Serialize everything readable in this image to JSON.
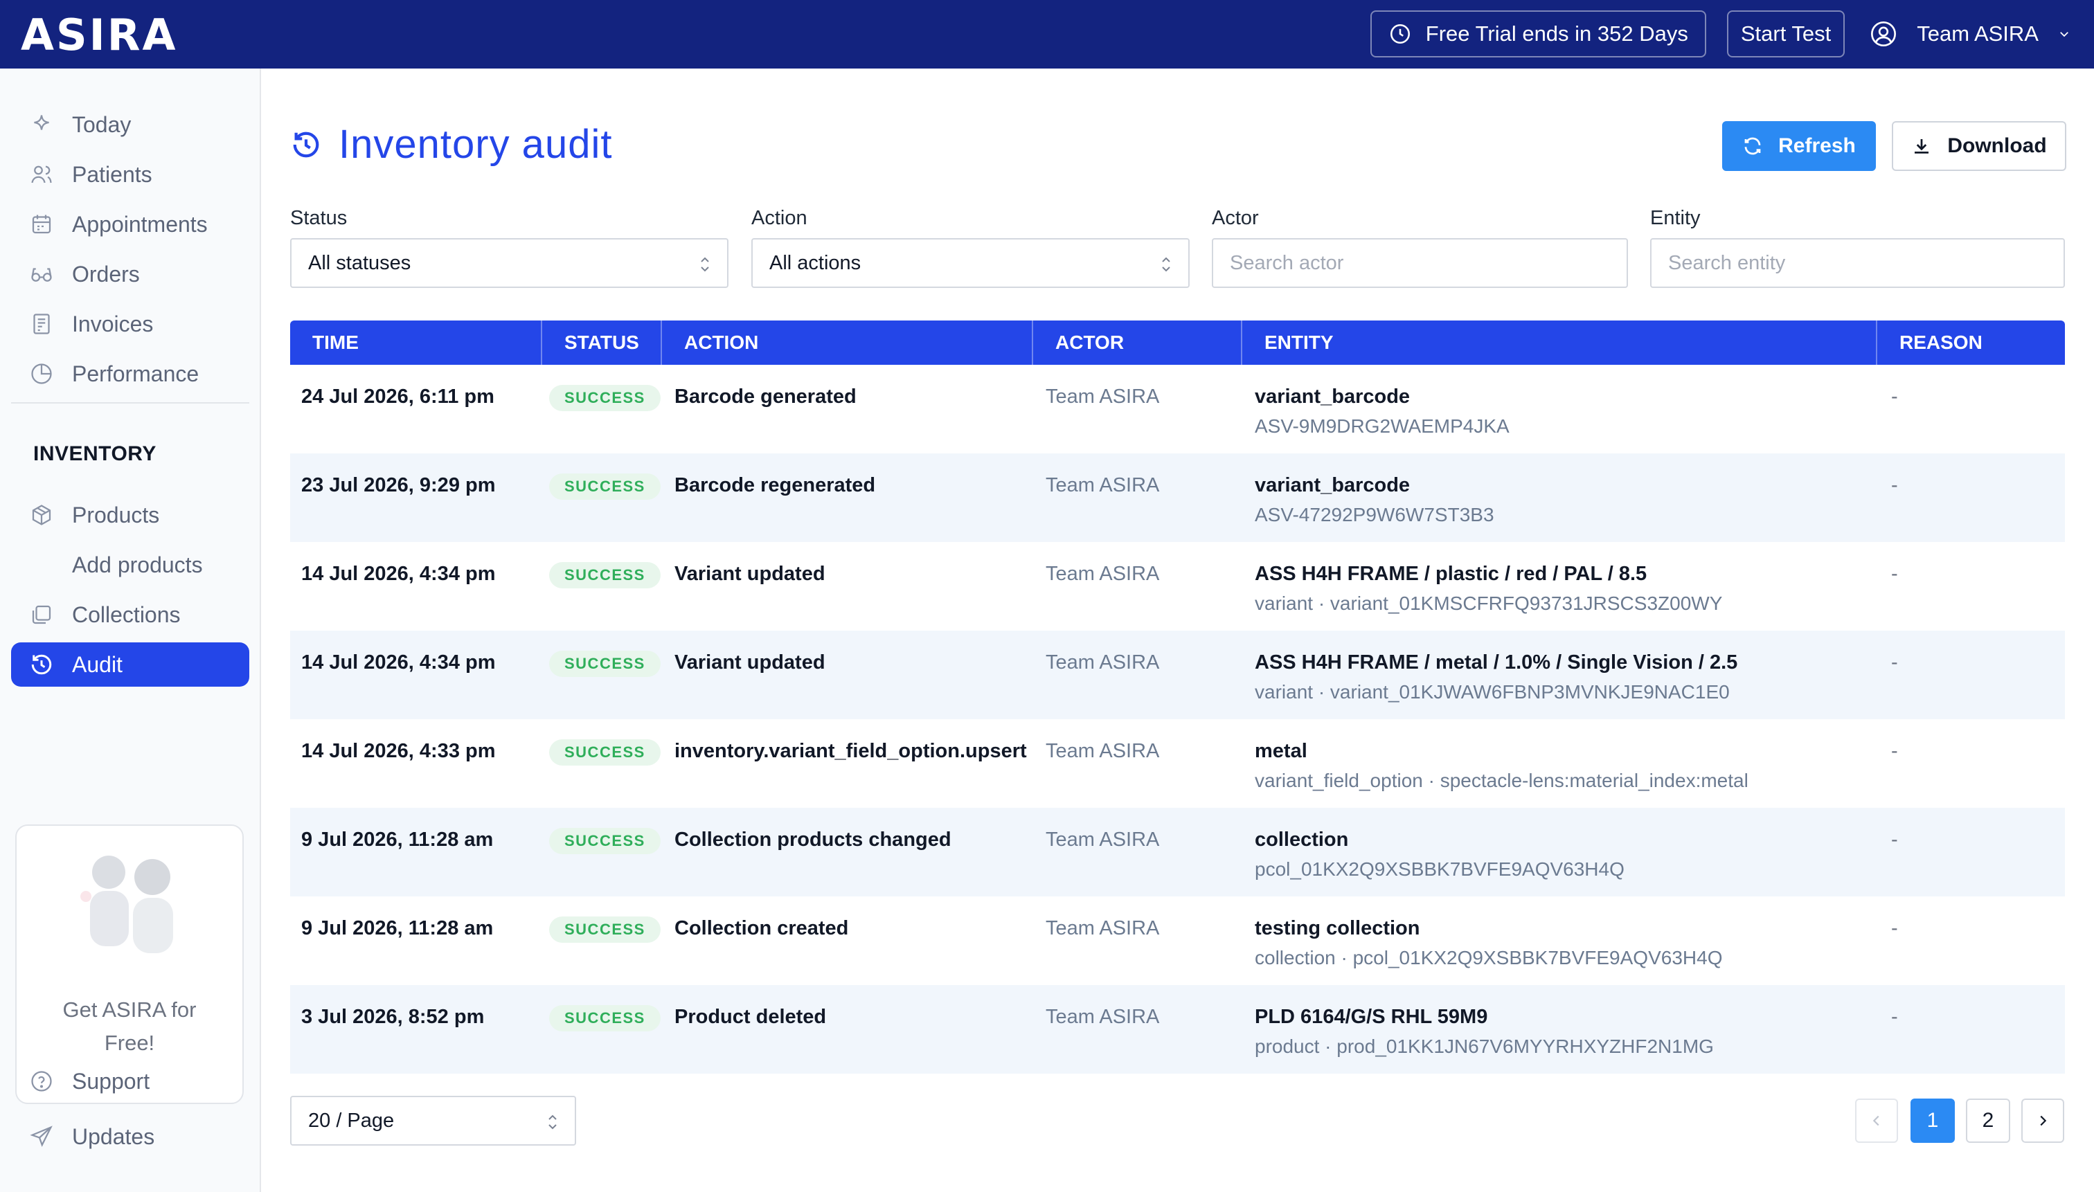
{
  "brand": {
    "logo": "ASIRA"
  },
  "topbar": {
    "trial_label": "Free Trial ends in 352 Days",
    "start_test_label": "Start Test",
    "team_label": "Team ASIRA"
  },
  "sidebar": {
    "items": [
      {
        "label": "Today",
        "icon": "sparkle-icon"
      },
      {
        "label": "Patients",
        "icon": "users-icon"
      },
      {
        "label": "Appointments",
        "icon": "calendar-icon"
      },
      {
        "label": "Orders",
        "icon": "glasses-icon"
      },
      {
        "label": "Invoices",
        "icon": "receipt-icon"
      },
      {
        "label": "Performance",
        "icon": "pie-chart-icon"
      }
    ],
    "section_title": "INVENTORY",
    "inventory_items": [
      {
        "label": "Products",
        "icon": "cube-icon"
      },
      {
        "label": "Add products"
      },
      {
        "label": "Collections",
        "icon": "collections-icon"
      },
      {
        "label": "Audit",
        "icon": "history-icon",
        "active": true
      }
    ],
    "promo_text": "Get ASIRA for Free!",
    "bottom_items": [
      {
        "label": "Support",
        "icon": "help-circle-icon"
      },
      {
        "label": "Updates",
        "icon": "send-icon"
      }
    ]
  },
  "page": {
    "title": "Inventory audit",
    "refresh_label": "Refresh",
    "download_label": "Download"
  },
  "filters": {
    "status": {
      "label": "Status",
      "value": "All statuses"
    },
    "action": {
      "label": "Action",
      "value": "All actions"
    },
    "actor": {
      "label": "Actor",
      "placeholder": "Search actor"
    },
    "entity": {
      "label": "Entity",
      "placeholder": "Search entity"
    }
  },
  "table": {
    "headers": [
      "TIME",
      "STATUS",
      "ACTION",
      "ACTOR",
      "ENTITY",
      "REASON"
    ],
    "rows": [
      {
        "time": "24 Jul 2026, 6:11 pm",
        "status": "SUCCESS",
        "action": "Barcode generated",
        "actor": "Team ASIRA",
        "entity_title": "variant_barcode",
        "entity_sub": "ASV-9M9DRG2WAEMP4JKA",
        "reason": "-"
      },
      {
        "time": "23 Jul 2026, 9:29 pm",
        "status": "SUCCESS",
        "action": "Barcode regenerated",
        "actor": "Team ASIRA",
        "entity_title": "variant_barcode",
        "entity_sub": "ASV-47292P9W6W7ST3B3",
        "reason": "-"
      },
      {
        "time": "14 Jul 2026, 4:34 pm",
        "status": "SUCCESS",
        "action": "Variant updated",
        "actor": "Team ASIRA",
        "entity_title": "ASS H4H FRAME / plastic / red / PAL / 8.5",
        "entity_sub": "variant · variant_01KMSCFRFQ93731JRSCS3Z00WY",
        "reason": "-"
      },
      {
        "time": "14 Jul 2026, 4:34 pm",
        "status": "SUCCESS",
        "action": "Variant updated",
        "actor": "Team ASIRA",
        "entity_title": "ASS H4H FRAME / metal / 1.0% / Single Vision / 2.5",
        "entity_sub": "variant · variant_01KJWAW6FBNP3MVNKJE9NAC1E0",
        "reason": "-"
      },
      {
        "time": "14 Jul 2026, 4:33 pm",
        "status": "SUCCESS",
        "action": "inventory.variant_field_option.upsert",
        "actor": "Team ASIRA",
        "entity_title": "metal",
        "entity_sub": "variant_field_option · spectacle-lens:material_index:metal",
        "reason": "-"
      },
      {
        "time": "9 Jul 2026, 11:28 am",
        "status": "SUCCESS",
        "action": "Collection products changed",
        "actor": "Team ASIRA",
        "entity_title": "collection",
        "entity_sub": "pcol_01KX2Q9XSBBK7BVFE9AQV63H4Q",
        "reason": "-"
      },
      {
        "time": "9 Jul 2026, 11:28 am",
        "status": "SUCCESS",
        "action": "Collection created",
        "actor": "Team ASIRA",
        "entity_title": "testing collection",
        "entity_sub": "collection · pcol_01KX2Q9XSBBK7BVFE9AQV63H4Q",
        "reason": "-"
      },
      {
        "time": "3 Jul 2026, 8:52 pm",
        "status": "SUCCESS",
        "action": "Product deleted",
        "actor": "Team ASIRA",
        "entity_title": "PLD 6164/G/S RHL 59M9",
        "entity_sub": "product · prod_01KK1JN67V6MYYRHXYZHF2N1MG",
        "reason": "-"
      }
    ]
  },
  "pagination": {
    "page_size": "20 / Page",
    "pages": [
      "1",
      "2"
    ],
    "current": "1"
  },
  "colors": {
    "topbar": "#13237f",
    "accent": "#2446e8",
    "button_primary": "#2b8af3",
    "success_text": "#2fae5a",
    "success_bg": "#e8f6ec",
    "row_alt": "#f1f6fc"
  }
}
